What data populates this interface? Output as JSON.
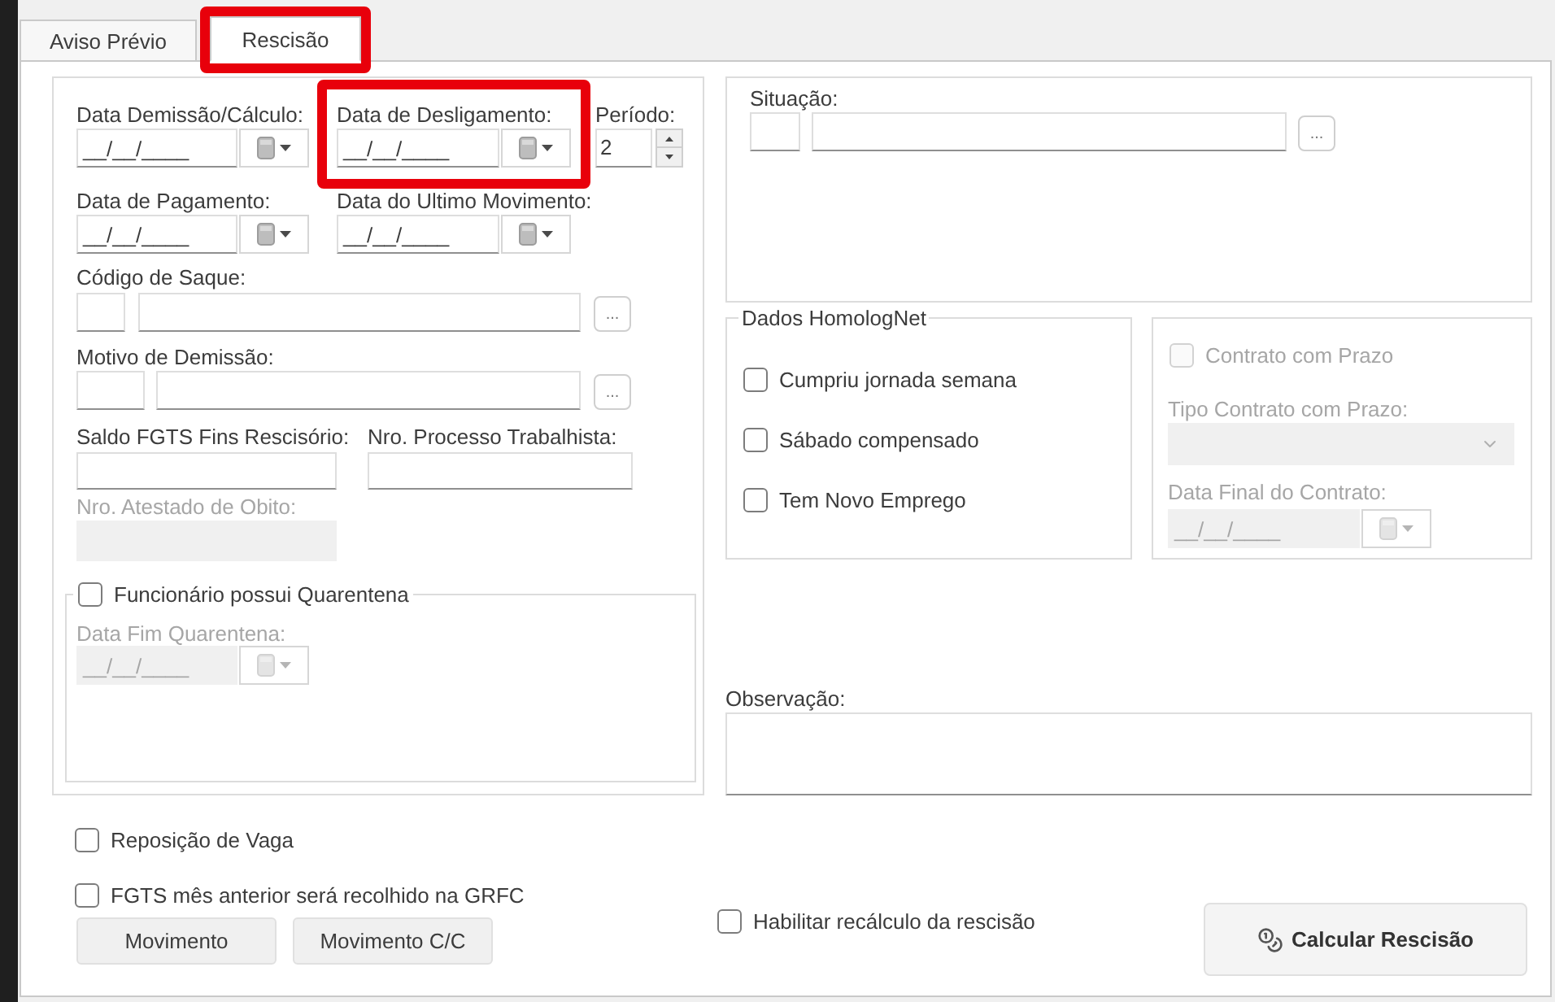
{
  "tabs": [
    {
      "label": "Aviso Prévio",
      "selected": false,
      "highlighted": false
    },
    {
      "label": "Rescisão",
      "selected": true,
      "highlighted": true
    }
  ],
  "date_rows": [
    [
      {
        "label": "Data Demissão/Cálculo:",
        "value": "__/__/____",
        "highlighted": false
      },
      {
        "label": "Data de Desligamento:",
        "value": "__/__/____",
        "highlighted": true
      }
    ],
    [
      {
        "label": "Data de Pagamento:",
        "value": "__/__/____",
        "highlighted": false
      },
      {
        "label": "Data do Ultimo Movimento:",
        "value": "__/__/____",
        "highlighted": false
      }
    ]
  ],
  "periodo": {
    "label": "Período:",
    "value": "2"
  },
  "lookups": [
    {
      "label": "Código de Saque:",
      "button": "..."
    },
    {
      "label": "Motivo de Demissão:",
      "button": "..."
    }
  ],
  "text_fields": [
    {
      "label": "Saldo FGTS Fins Rescisório:",
      "disabled": false
    },
    {
      "label": "Nro. Processo Trabalhista:",
      "disabled": false
    }
  ],
  "atestado": {
    "label": "Nro. Atestado de Obito:",
    "disabled": true
  },
  "quarentena": {
    "label": "Funcionário possui Quarentena",
    "checked": false,
    "date_label": "Data Fim Quarentena:",
    "date_value": "__/__/____",
    "disabled": true
  },
  "situacao": {
    "label": "Situação:",
    "button": "..."
  },
  "homolognet": {
    "title": "Dados HomologNet",
    "options": [
      {
        "label": "Cumpriu jornada semana",
        "checked": false
      },
      {
        "label": "Sábado compensado",
        "checked": false
      },
      {
        "label": "Tem Novo Emprego",
        "checked": false
      }
    ]
  },
  "contrato": {
    "label": "Contrato com Prazo",
    "checked": false,
    "disabled": true,
    "tipo_label": "Tipo Contrato com Prazo:",
    "data_final_label": "Data Final do Contrato:",
    "data_final_value": "__/__/____"
  },
  "observacao": {
    "label": "Observação:"
  },
  "options": [
    {
      "label": "Reposição de Vaga",
      "checked": false
    },
    {
      "label": "FGTS mês anterior será recolhido na GRFC",
      "checked": false
    }
  ],
  "buttons": [
    "Movimento",
    "Movimento C/C"
  ],
  "recalculo": {
    "label": "Habilitar recálculo da rescisão",
    "checked": false
  },
  "calcular": "Calcular Rescisão"
}
